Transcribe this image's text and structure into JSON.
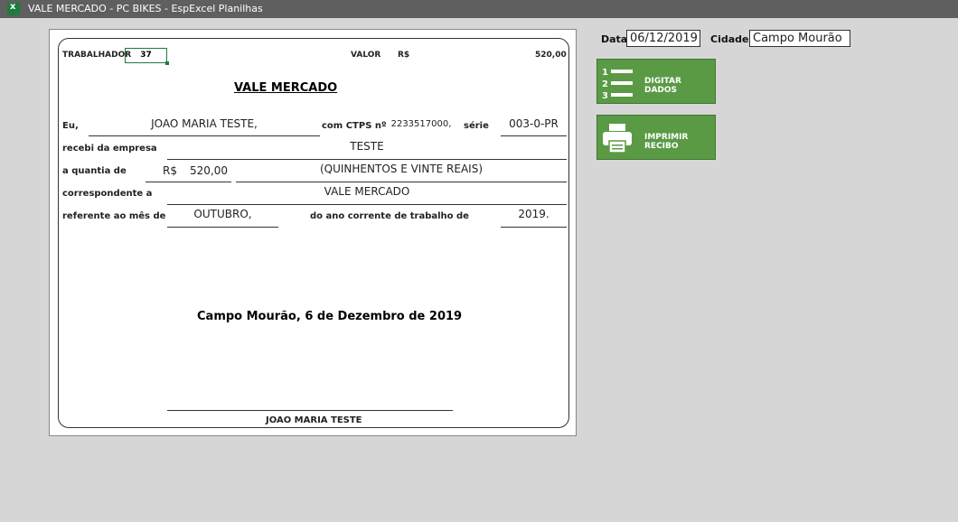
{
  "window": {
    "title": "VALE MERCADO - PC BIKES - EspExcel Planilhas"
  },
  "sheet": {
    "trabalhador_label": "TRABALHADOR",
    "trabalhador_value": "37",
    "valor_label": "VALOR",
    "currency_short": "R$",
    "valor_value": "520,00",
    "heading": "VALE MERCADO",
    "eu_label": "Eu,",
    "name_value": "JOAO MARIA TESTE,",
    "ctps_label": "com CTPS nº",
    "ctps_value": "2233517000,",
    "serie_label": "série",
    "serie_value": "003-0-PR",
    "empresa_label": "recebi da empresa",
    "empresa_value": "TESTE",
    "quantia_label": "a quantia de",
    "quantia_currency": "R$",
    "quantia_value": "520,00",
    "quantia_extenso": "(QUINHENTOS E VINTE REAIS)",
    "corresp_label": "correspondente a",
    "corresp_value": "VALE MERCADO",
    "ref_label": "referente ao mês de",
    "mes_value": "OUTUBRO,",
    "ano_label": "do ano corrente de trabalho de",
    "ano_value": "2019.",
    "date_line": "Campo Mourão, 6 de Dezembro de 2019",
    "signature_name": "JOAO MARIA TESTE"
  },
  "side": {
    "data_label": "Data",
    "data_value": "06/12/2019",
    "cidade_label": "Cidade",
    "cidade_value": "Campo Mourão"
  },
  "buttons": {
    "digitar": {
      "label": "DIGITAR DADOS",
      "icon": "numbered-list-icon"
    },
    "imprimir": {
      "label": "IMPRIMIR RECIBO",
      "icon": "printer-icon"
    }
  },
  "colors": {
    "button_green": "#5a9a45",
    "selection_green": "#1e7b3c",
    "titlebar": "#5f5f5f"
  }
}
